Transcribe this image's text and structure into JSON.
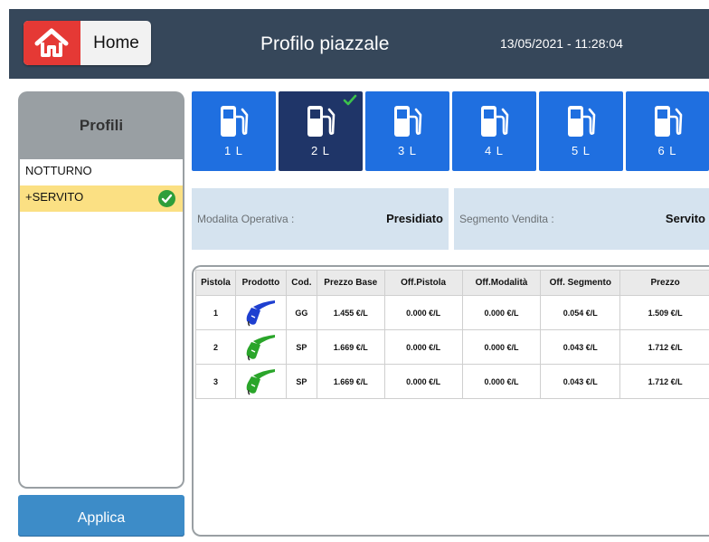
{
  "header": {
    "home_label": "Home",
    "title": "Profilo piazzale",
    "datetime": "13/05/2021 - 11:28:04"
  },
  "sidebar": {
    "title": "Profili",
    "profiles": [
      {
        "label": "NOTTURNO",
        "selected": false
      },
      {
        "label": "+SERVITO",
        "selected": true
      }
    ],
    "apply_label": "Applica"
  },
  "pumps": [
    {
      "label": "1 L",
      "active": false
    },
    {
      "label": "2 L",
      "active": true
    },
    {
      "label": "3 L",
      "active": false
    },
    {
      "label": "4 L",
      "active": false
    },
    {
      "label": "5 L",
      "active": false
    },
    {
      "label": "6 L",
      "active": false
    }
  ],
  "info": {
    "modalita_label": "Modalita Operativa :",
    "modalita_value": "Presidiato",
    "segmento_label": "Segmento Vendita :",
    "segmento_value": "Servito"
  },
  "table": {
    "headers": [
      "Pistola",
      "Prodotto",
      "Cod.",
      "Prezzo Base",
      "Off.Pistola",
      "Off.Modalità",
      "Off. Segmento",
      "Prezzo"
    ],
    "rows": [
      {
        "pistola": "1",
        "nozzle_color": "#1e3fd0",
        "cod": "GG",
        "prezzo_base": "1.455 €/L",
        "off_pistola": "0.000 €/L",
        "off_modalita": "0.000 €/L",
        "off_segmento": "0.054 €/L",
        "prezzo": "1.509 €/L"
      },
      {
        "pistola": "2",
        "nozzle_color": "#2aa52a",
        "cod": "SP",
        "prezzo_base": "1.669 €/L",
        "off_pistola": "0.000 €/L",
        "off_modalita": "0.000 €/L",
        "off_segmento": "0.043 €/L",
        "prezzo": "1.712 €/L"
      },
      {
        "pistola": "3",
        "nozzle_color": "#2aa52a",
        "cod": "SP",
        "prezzo_base": "1.669 €/L",
        "off_pistola": "0.000 €/L",
        "off_modalita": "0.000 €/L",
        "off_segmento": "0.043 €/L",
        "prezzo": "1.712 €/L"
      }
    ]
  },
  "colors": {
    "header_bg": "#36475a",
    "home_red": "#e53935",
    "pump_blue": "#1f6fe0",
    "pump_active": "#1f3568",
    "selected_profile": "#fbe083",
    "check_green": "#2e9e3a",
    "apply_blue": "#3d8cc8",
    "info_bg": "#d5e3ef"
  }
}
